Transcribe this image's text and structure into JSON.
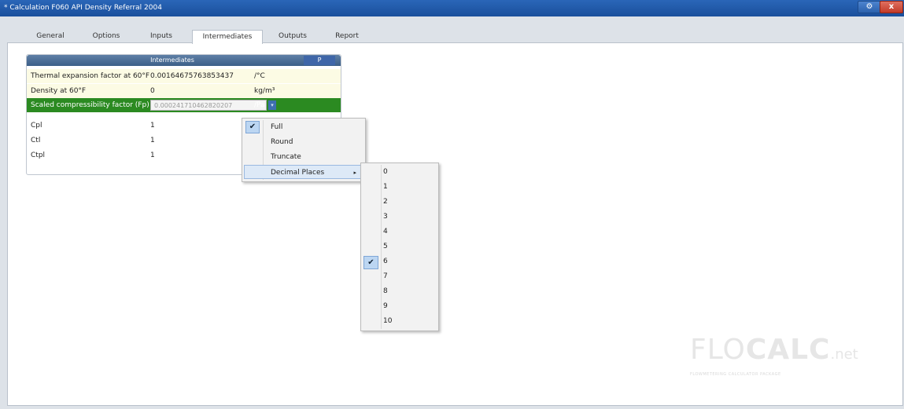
{
  "window": {
    "title": "* Calculation F060 API Density Referral 2004",
    "settings_glyph": "⚙",
    "close_glyph": "x"
  },
  "tabs": [
    {
      "label": "General",
      "active": false
    },
    {
      "label": "Options",
      "active": false
    },
    {
      "label": "Inputs",
      "active": false
    },
    {
      "label": "Intermediates",
      "active": true
    },
    {
      "label": "Outputs",
      "active": false
    },
    {
      "label": "Report",
      "active": false
    }
  ],
  "panel": {
    "title": "Intermediates",
    "p_label": "P",
    "rows": [
      {
        "name": "Thermal expansion factor at 60°F",
        "value": "0.00164675763853437",
        "unit": "/°C"
      },
      {
        "name": "Density at 60°F",
        "value": "0",
        "unit": "kg/m³"
      },
      {
        "name": "Scaled compressibility factor (Fp)",
        "value": "0.000241710462820207",
        "unit": "/Pa"
      },
      {
        "name": "Cpl",
        "value": "1",
        "unit": ""
      },
      {
        "name": "Ctl",
        "value": "1",
        "unit": ""
      },
      {
        "name": "Ctpl",
        "value": "1",
        "unit": ""
      }
    ]
  },
  "context_menu": {
    "items": [
      {
        "label": "Full",
        "checked": true
      },
      {
        "label": "Round",
        "checked": false
      },
      {
        "label": "Truncate",
        "checked": false
      },
      {
        "label": "Decimal Places",
        "checked": false,
        "submenu": true
      }
    ],
    "check_glyph": "✔",
    "arrow_glyph": "▸"
  },
  "decimal_places_submenu": {
    "items": [
      "0",
      "1",
      "2",
      "3",
      "4",
      "5",
      "6",
      "7",
      "8",
      "9",
      "10"
    ],
    "selected": "6"
  },
  "watermark": {
    "flo": "FLO",
    "calc": "CALC",
    "net": ".net",
    "tagline": "FLOWMETERING CALCULATOR PACKAGE"
  },
  "colors": {
    "title_bar": "#1f58a8",
    "selected_row": "#2b8a21",
    "highlight_row": "#fcfbe4"
  }
}
